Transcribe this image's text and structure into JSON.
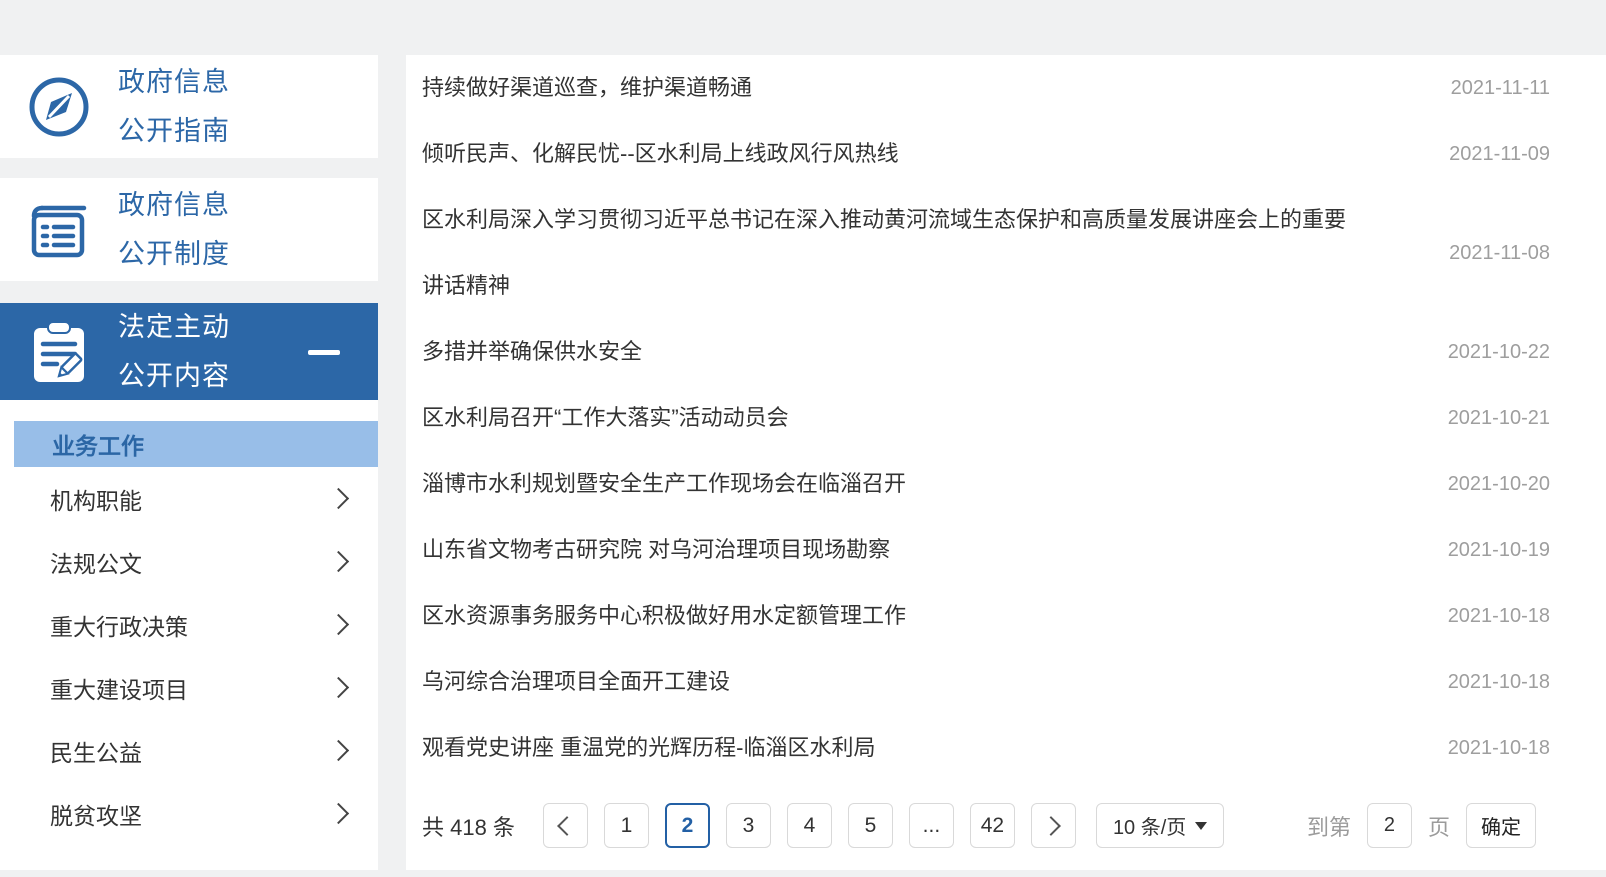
{
  "sidebar": {
    "items": [
      {
        "line1": "政府信息",
        "line2": "公开指南"
      },
      {
        "line1": "政府信息",
        "line2": "公开制度"
      },
      {
        "line1": "法定主动",
        "line2": "公开内容"
      }
    ],
    "submenu_active": {
      "label": "业务工作"
    },
    "submenu": [
      {
        "label": "机构职能"
      },
      {
        "label": "法规公文"
      },
      {
        "label": "重大行政决策"
      },
      {
        "label": "重大建设项目"
      },
      {
        "label": "民生公益"
      },
      {
        "label": "脱贫攻坚"
      }
    ]
  },
  "news": {
    "items": [
      {
        "title": "持续做好渠道巡查，维护渠道畅通",
        "date": "2021-11-11"
      },
      {
        "title": "倾听民声、化解民忧--区水利局上线政风行风热线",
        "date": "2021-11-09"
      },
      {
        "title": "区水利局深入学习贯彻习近平总书记在深入推动黄河流域生态保护和高质量发展讲座会上的重要讲话精神",
        "date": "2021-11-08"
      },
      {
        "title": "多措并举确保供水安全",
        "date": "2021-10-22"
      },
      {
        "title": "区水利局召开“工作大落实”活动动员会",
        "date": "2021-10-21"
      },
      {
        "title": "淄博市水利规划暨安全生产工作现场会在临淄召开",
        "date": "2021-10-20"
      },
      {
        "title": "山东省文物考古研究院 对乌河治理项目现场勘察",
        "date": "2021-10-19"
      },
      {
        "title": "区水资源事务服务中心积极做好用水定额管理工作",
        "date": "2021-10-18"
      },
      {
        "title": "乌河综合治理项目全面开工建设",
        "date": "2021-10-18"
      },
      {
        "title": "观看党史讲座 重温党的光辉历程-临淄区水利局",
        "date": "2021-10-18"
      }
    ]
  },
  "pagination": {
    "total": "共 418 条",
    "pages": [
      {
        "label": "1"
      },
      {
        "label": "2",
        "active": true
      },
      {
        "label": "3"
      },
      {
        "label": "4"
      },
      {
        "label": "5"
      },
      {
        "label": "...",
        "ellipsis": true
      },
      {
        "label": "42"
      }
    ],
    "page_size": "10 条/页",
    "goto_prefix": "到第",
    "goto_value": "2",
    "goto_suffix": "页",
    "confirm_label": "确定"
  },
  "colors": {
    "accent_blue": "#2c67a7",
    "active_page_blue": "#2360a5",
    "submenu_highlight": "#98bee8",
    "date_gray": "#9e9e9e",
    "page_background": "#f0f1f2"
  }
}
